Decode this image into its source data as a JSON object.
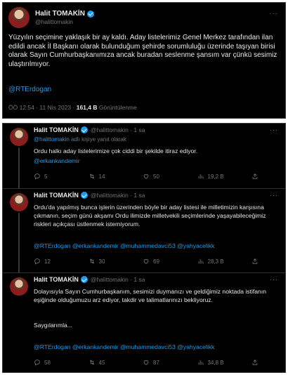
{
  "main_tweet": {
    "name": "Halit TOMAKİN",
    "handle": "@halittomakin",
    "text": "Yüzyılın seçimine yaklaşık bir ay kaldı. Aday listelerimiz Genel Merkez tarafından ilan edildi ancak İl Başkanı olarak bulunduğum şehirde sorumluluğu üzerinde taşıyan birisi olarak Sayın Cumhurbaşkanımıza ancak buradan seslenme şansım var çünkü sesimiz ulaştırılmıyor.",
    "mention": "@RTErdogan",
    "time": "ÖÖ 12:54 · 11 Nis 2023 ·",
    "views_count": "161,4 B",
    "views_label": "Görüntülenme"
  },
  "thread": [
    {
      "name": "Halit TOMAKİN",
      "handle_time": "@halittomakin · 1 sa",
      "reply_prefix": "@halittomakin",
      "reply_suffix": " adlı kişiye yanıt olarak",
      "text": "Ordu halkı aday listelerimize çok ciddi bir şekilde itiraz ediyor.",
      "mentions": "@erkankandemir",
      "stats": {
        "replies": "5",
        "retweets": "14",
        "likes": "50",
        "views": "19,2 B"
      }
    },
    {
      "name": "Halit TOMAKİN",
      "handle_time": "@halittomakin · 1 sa",
      "text": "Ordu'da yapılmış bunca işlerin üzerinden böyle bir aday listesi ile milletimizin karşısına çıkmanın, seçim günü akşamı Ordu ilimizde milletvekili seçimlerinde yaşayabileceğimiz riskleri açıkçası üstlenmek istemiyorum.",
      "mentions": "@RTErdogan @erkankandemir @muhammedavci53 @yahyacelikk",
      "stats": {
        "replies": "12",
        "retweets": "30",
        "likes": "69",
        "views": "28,3 B"
      }
    },
    {
      "name": "Halit TOMAKİN",
      "handle_time": "@halittomakin · 1 sa",
      "text": "Dolayısıyla Sayın Cumhurbaşkanım, sesimizi duymanızı ve geldiğimiz noktada istifanın eşiğinde olduğumuzu arz ediyor, takdir ve talimatlarınızı bekliyoruz.",
      "closing": "Saygılarımla...",
      "mentions": "@RTErdogan @erkankandemir @muhammedavci53 @yahyacelikk",
      "stats": {
        "replies": "58",
        "retweets": "45",
        "likes": "87",
        "views": "34,8 B"
      }
    }
  ],
  "colors": {
    "background": "#000000",
    "text": "#e7e9ea",
    "muted": "#71767b",
    "link": "#1d9bf0"
  }
}
